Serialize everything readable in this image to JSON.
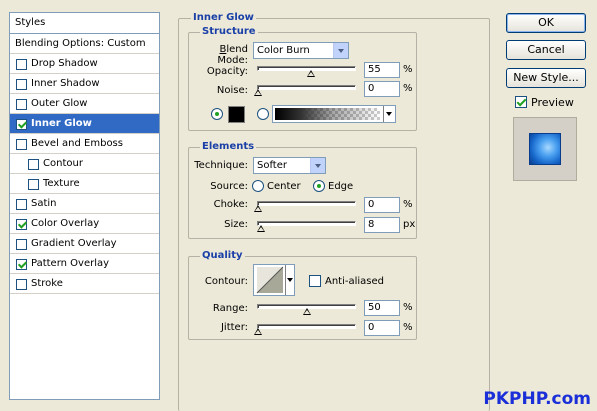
{
  "styles_panel": {
    "header": "Styles",
    "blending_options": "Blending Options: Custom",
    "items": [
      {
        "label": "Drop Shadow",
        "checked": false,
        "selected": false
      },
      {
        "label": "Inner Shadow",
        "checked": false,
        "selected": false
      },
      {
        "label": "Outer Glow",
        "checked": false,
        "selected": false
      },
      {
        "label": "Inner Glow",
        "checked": true,
        "selected": true
      },
      {
        "label": "Bevel and Emboss",
        "checked": false,
        "selected": false
      },
      {
        "label": "Contour",
        "checked": false,
        "selected": false
      },
      {
        "label": "Texture",
        "checked": false,
        "selected": false
      },
      {
        "label": "Satin",
        "checked": false,
        "selected": false
      },
      {
        "label": "Color Overlay",
        "checked": true,
        "selected": false
      },
      {
        "label": "Gradient Overlay",
        "checked": false,
        "selected": false
      },
      {
        "label": "Pattern Overlay",
        "checked": true,
        "selected": false
      },
      {
        "label": "Stroke",
        "checked": false,
        "selected": false
      }
    ]
  },
  "inner_glow": {
    "title": "Inner Glow",
    "structure": {
      "title": "Structure",
      "blend_mode_label": "Blend Mode:",
      "blend_mode_value": "Color Burn",
      "opacity_label": "Opacity:",
      "opacity_value": "55",
      "opacity_unit": "%",
      "opacity_level": 0.55,
      "noise_label": "Noise:",
      "noise_value": "0",
      "noise_unit": "%",
      "noise_level": 0,
      "color_source": "solid",
      "glow_color": "#000000"
    },
    "elements": {
      "title": "Elements",
      "technique_label": "Technique:",
      "technique_value": "Softer",
      "source_label": "Source:",
      "source_center": "Center",
      "source_edge": "Edge",
      "source_selected": "Edge",
      "choke_label": "Choke:",
      "choke_value": "0",
      "choke_unit": "%",
      "choke_level": 0,
      "size_label": "Size:",
      "size_value": "8",
      "size_unit": "px",
      "size_level": 0.032
    },
    "quality": {
      "title": "Quality",
      "contour_label": "Contour:",
      "anti_aliased_label": "Anti-aliased",
      "anti_aliased_checked": false,
      "range_label": "Range:",
      "range_value": "50",
      "range_unit": "%",
      "range_level": 0.5,
      "jitter_label": "Jitter:",
      "jitter_value": "0",
      "jitter_unit": "%",
      "jitter_level": 0
    }
  },
  "buttons": {
    "ok": "OK",
    "cancel": "Cancel",
    "new_style": "New Style...",
    "preview_label": "Preview",
    "preview_checked": true
  },
  "watermark": "PKPHP.com",
  "colors": {
    "accent": "#316ac5",
    "group_title": "#1a40a8",
    "dialog_bg": "#ece9d8",
    "watermark": "#1a2fd8"
  }
}
